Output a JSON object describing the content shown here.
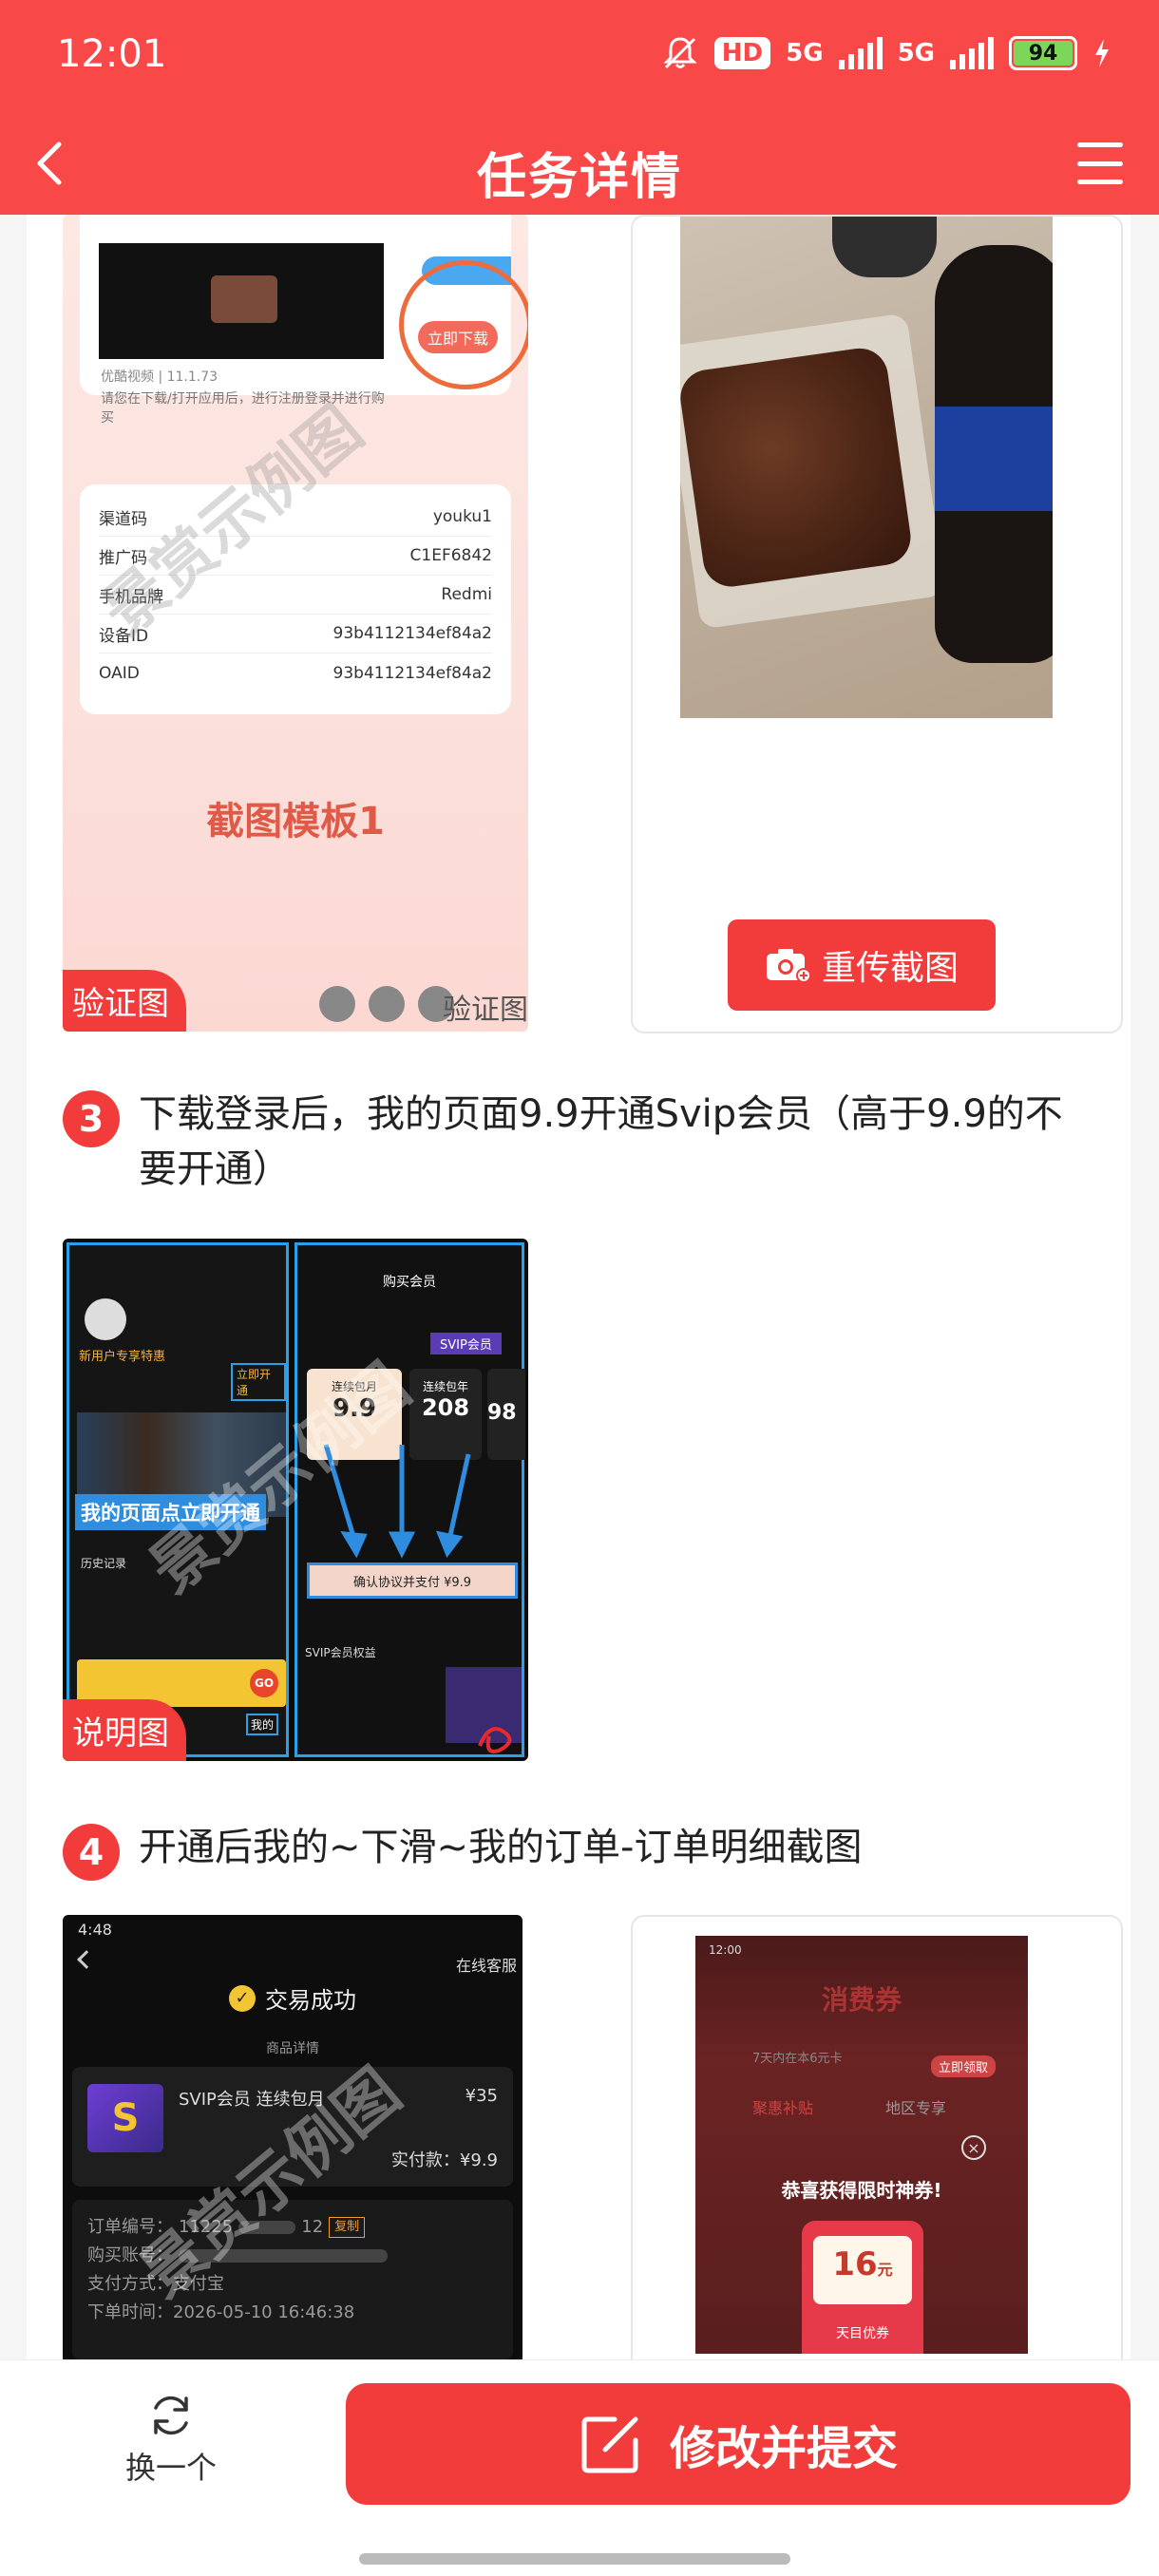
{
  "status_bar": {
    "time": "12:01",
    "hd_badge": "HD",
    "signal_1": "5G",
    "signal_2": "5G",
    "battery": "94"
  },
  "header": {
    "title": "任务详情"
  },
  "step2": {
    "template": {
      "video_title": "优酷视频 | 11.1.73",
      "video_note": "请您在下载/打开应用后，进行注册登录并进行购买",
      "download_button": "立即下载",
      "rows": [
        {
          "label": "渠道码",
          "value": "youku1"
        },
        {
          "label": "推广码",
          "value": "C1EF6842"
        },
        {
          "label": "手机品牌",
          "value": "Redmi"
        },
        {
          "label": "设备ID",
          "value": "93b4112134ef84a2"
        },
        {
          "label": "OAID",
          "value": "93b4112134ef84a2"
        }
      ],
      "caption": "截图模板1"
    },
    "left_tag": "验证图",
    "bottom_right_label": "验证图",
    "reupload_label": "重传截图"
  },
  "step3": {
    "number": "3",
    "text": "下载登录后，我的页面9.9开通Svip会员（高于9.9的不要开通）",
    "image": {
      "left_title": "我的页面点立即开通",
      "right_title": "购买会员",
      "price_1": "9.9",
      "price_2": "208",
      "price_3": "98",
      "plan_1": "连续包月",
      "plan_2": "连续包年",
      "confirm_bar": "确认协议并支付 ¥9.9",
      "svip_label": "SVIP会员",
      "benefits": "SVIP会员权益",
      "new_user": "新用户专享特惠",
      "open_now": "立即开通",
      "history": "历史记录",
      "go": "GO",
      "mine": "我的"
    },
    "tag": "说明图"
  },
  "step4": {
    "number": "4",
    "text": "开通后我的~下滑~我的订单-订单明细截图",
    "order": {
      "time": "4:48",
      "online_service": "在线客服",
      "status": "交易成功",
      "section": "商品详情",
      "product": "SVIP会员 连续包月",
      "price": "¥35",
      "paid": "实付款：¥9.9",
      "order_no_label": "订单编号：",
      "order_no": "11225",
      "order_no_end": "12",
      "copy": "复制",
      "buyer_label": "购买账号：",
      "pay_label": "支付方式：",
      "pay_value": "支付宝",
      "time_label": "下单时间：",
      "time_value": "2026-05-10 16:46:38"
    },
    "coupon": {
      "time": "12:00",
      "title": "消费券",
      "tab_1": "聚惠补贴",
      "tab_2": "地区专享",
      "subtitle": "7天内在本6元卡",
      "congrats": "恭喜获得限时神券!",
      "amount": "16",
      "unit": "元",
      "expand": "天目优券",
      "get_now": "立即领取"
    }
  },
  "watermark": "景赏示例图",
  "bottom": {
    "swap_label": "换一个",
    "submit_label": "修改并提交"
  }
}
